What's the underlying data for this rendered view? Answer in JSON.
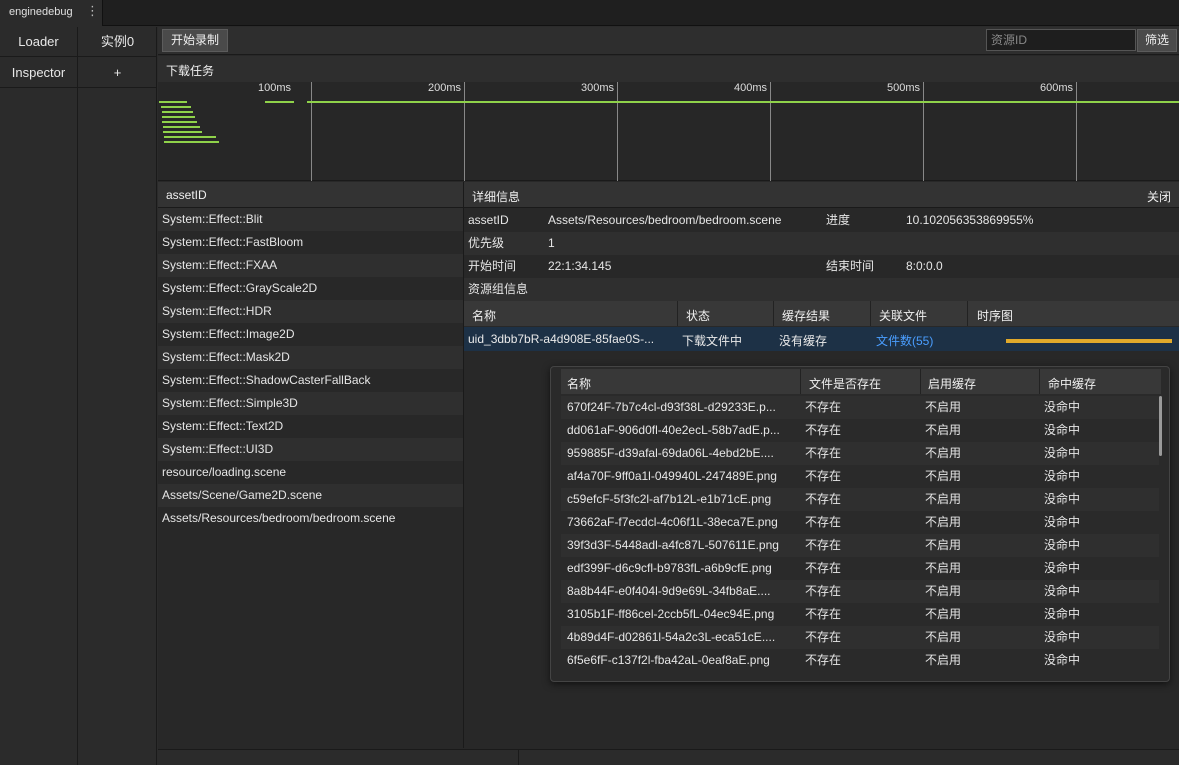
{
  "titlebar": {
    "tab_label": "enginedebug",
    "kebab": "⋮"
  },
  "sidebar": {
    "rows": [
      {
        "left": "Loader",
        "right": "实例0"
      },
      {
        "left": "Inspector",
        "right": "+"
      }
    ]
  },
  "toolbar": {
    "record_label": "开始录制",
    "search_placeholder": "资源ID",
    "filter_label": "筛选"
  },
  "download_section": {
    "title": "下载任务"
  },
  "timeline": {
    "ticks": [
      "100ms",
      "200ms",
      "300ms",
      "400ms",
      "500ms",
      "600ms"
    ]
  },
  "asset_list": {
    "header": "assetID",
    "items": [
      "System::Effect::Blit",
      "System::Effect::FastBloom",
      "System::Effect::FXAA",
      "System::Effect::GrayScale2D",
      "System::Effect::HDR",
      "System::Effect::Image2D",
      "System::Effect::Mask2D",
      "System::Effect::ShadowCasterFallBack",
      "System::Effect::Simple3D",
      "System::Effect::Text2D",
      "System::Effect::UI3D",
      "resource/loading.scene",
      "Assets/Scene/Game2D.scene",
      "Assets/Resources/bedroom/bedroom.scene"
    ]
  },
  "detail": {
    "title": "详细信息",
    "close_label": "关闭",
    "assetid_label": "assetID",
    "assetid_value": "Assets/Resources/bedroom/bedroom.scene",
    "progress_label": "进度",
    "progress_value": "10.102056353869955%",
    "priority_label": "优先级",
    "priority_value": "1",
    "start_label": "开始时间",
    "start_value": "22:1:34.145",
    "end_label": "结束时间",
    "end_value": "8:0:0.0",
    "group_info_label": "资源组信息"
  },
  "group_table": {
    "headers": [
      "名称",
      "状态",
      "缓存结果",
      "关联文件",
      "时序图"
    ],
    "row": {
      "name": "uid_3dbb7bR-a4d908E-85fae0S-...",
      "status": "下载文件中",
      "cache": "没有缓存",
      "files": "文件数(55)"
    }
  },
  "file_popup": {
    "headers": [
      "名称",
      "文件是否存在",
      "启用缓存",
      "命中缓存"
    ],
    "rows": [
      [
        "670f24F-7b7c4cl-d93f38L-d29233E.p...",
        "不存在",
        "不启用",
        "没命中"
      ],
      [
        "dd061aF-906d0fl-40e2ecL-58b7adE.p...",
        "不存在",
        "不启用",
        "没命中"
      ],
      [
        "959885F-d39afal-69da06L-4ebd2bE....",
        "不存在",
        "不启用",
        "没命中"
      ],
      [
        "af4a70F-9ff0a1l-049940L-247489E.png",
        "不存在",
        "不启用",
        "没命中"
      ],
      [
        "c59efcF-5f3fc2l-af7b12L-e1b71cE.png",
        "不存在",
        "不启用",
        "没命中"
      ],
      [
        "73662aF-f7ecdcl-4c06f1L-38eca7E.png",
        "不存在",
        "不启用",
        "没命中"
      ],
      [
        "39f3d3F-5448adl-a4fc87L-507611E.png",
        "不存在",
        "不启用",
        "没命中"
      ],
      [
        "edf399F-d6c9cfl-b9783fL-a6b9cfE.png",
        "不存在",
        "不启用",
        "没命中"
      ],
      [
        "8a8b44F-e0f404l-9d9e69L-34fb8aE....",
        "不存在",
        "不启用",
        "没命中"
      ],
      [
        "3105b1F-ff86cel-2ccb5fL-04ec94E.png",
        "不存在",
        "不启用",
        "没命中"
      ],
      [
        "4b89d4F-d02861l-54a2c3L-eca51cE....",
        "不存在",
        "不启用",
        "没命中"
      ],
      [
        "6f5e6fF-c137f2l-fba42aL-0eaf8aE.png",
        "不存在",
        "不启用",
        "没命中"
      ]
    ]
  },
  "colors": {
    "accent_green": "#8fd24a",
    "selected_row": "#1d3146",
    "link_blue": "#4a9eff",
    "timing_orange": "#e0a92b"
  }
}
